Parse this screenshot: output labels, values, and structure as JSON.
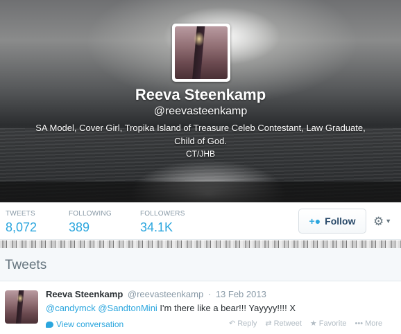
{
  "profile": {
    "name": "Reeva Steenkamp",
    "handle": "@reevasteenkamp",
    "bio": "SA Model, Cover Girl, Tropika Island of Treasure Celeb Contestant, Law Graduate, Child of God.",
    "location": "CT/JHB"
  },
  "stats": {
    "tweets_label": "TWEETS",
    "tweets_value": "8,072",
    "following_label": "FOLLOWING",
    "following_value": "389",
    "followers_label": "FOLLOWERS",
    "followers_value": "34.1K"
  },
  "follow_button": {
    "label": "Follow",
    "icon": "add-user-icon",
    "glyph": "+👤"
  },
  "settings_menu": {
    "icon": "gear-icon",
    "glyph": "⚙",
    "caret": "⌄"
  },
  "tweets_section": {
    "title": "Tweets"
  },
  "tweet": {
    "author": "Reeva Steenkamp",
    "handle": "@reevasteenkamp",
    "separator": "·",
    "date": "13 Feb 2013",
    "mention1": "@candymck",
    "mention2": "@SandtonMini",
    "text": " I'm there like a bear!!! Yayyyy!!!! X",
    "view_conversation": "View conversation",
    "actions": {
      "reply": "Reply",
      "retweet": "Retweet",
      "favorite": "Favorite",
      "more": "More",
      "reply_glyph": "↶",
      "retweet_glyph": "⇄",
      "favorite_glyph": "★",
      "more_glyph": "•••"
    }
  },
  "colors": {
    "link": "#2ba6de",
    "muted": "#8899a6",
    "text": "#292f33",
    "action_muted": "#b1bbc3"
  }
}
